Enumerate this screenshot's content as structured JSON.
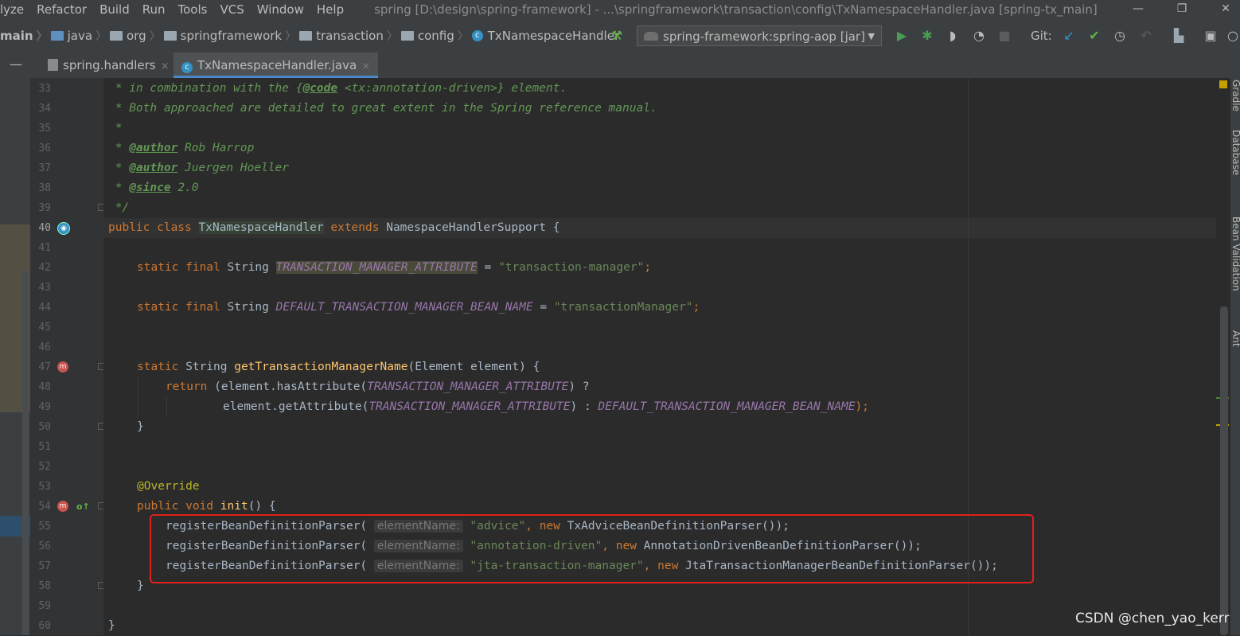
{
  "menu": [
    "lyze",
    "Refactor",
    "Build",
    "Run",
    "Tools",
    "VCS",
    "Window",
    "Help"
  ],
  "window_title": "spring [D:\\design\\spring-framework] - ...\\springframework\\transaction\\config\\TxNamespaceHandler.java [spring-tx_main]",
  "window_controls": {
    "minimize": "—",
    "restore": "❐",
    "close": "✕"
  },
  "breadcrumbs": [
    "main",
    "java",
    "org",
    "springframework",
    "transaction",
    "config",
    "TxNamespaceHandler"
  ],
  "run_config": "spring-framework:spring-aop [jar]",
  "toolbar": {
    "git_label": "Git:"
  },
  "icons": {
    "build": "hammer-icon",
    "run": "run-icon",
    "debug": "debug-icon",
    "coverage": "coverage-icon",
    "profile": "profile-icon",
    "stop": "stop-icon",
    "vcs_update": "vcs-update-icon",
    "vcs_commit": "vcs-commit-icon",
    "history": "history-icon",
    "rollback": "rollback-icon",
    "project_structure": "project-structure-icon",
    "terminal": "terminal-icon",
    "search": "search-icon"
  },
  "tabs": [
    {
      "label": "spring.handlers",
      "close": "×"
    },
    {
      "label": "TxNamespaceHandler.java",
      "close": "×"
    }
  ],
  "right_tool_windows": [
    "Gradle",
    "Database",
    "Bean Validation",
    "Ant"
  ],
  "line_numbers": [
    "33",
    "34",
    "35",
    "36",
    "37",
    "38",
    "39",
    "40",
    "41",
    "42",
    "43",
    "44",
    "45",
    "46",
    "47",
    "48",
    "49",
    "50",
    "51",
    "52",
    "53",
    "54",
    "55",
    "56",
    "57",
    "58",
    "59",
    "60"
  ],
  "code": {
    "l33": {
      "star": " * ",
      "t1": "in combination with the {",
      "tag": "@code",
      "t2": " <tx:annotation-driven>} element."
    },
    "l34": {
      "t": " * Both approached are detailed to great extent in the Spring reference manual."
    },
    "l35": {
      "t": " *"
    },
    "l36": {
      "star": " * ",
      "tag": "@author",
      "t": " Rob Harrop"
    },
    "l37": {
      "star": " * ",
      "tag": "@author",
      "t": " Juergen Hoeller"
    },
    "l38": {
      "star": " * ",
      "tag": "@since",
      "t": " 2.0"
    },
    "l39": {
      "t": " */"
    },
    "l40": {
      "kw1": "public class ",
      "cls": "TxNamespaceHandler",
      "kw2": " extends ",
      "t": "NamespaceHandlerSupport {"
    },
    "l42": {
      "kw": "static final ",
      "type": "String ",
      "fld": "TRANSACTION_MANAGER_ATTRIBUTE",
      "eq": " = ",
      "str": "\"transaction-manager\"",
      "end": ";"
    },
    "l44": {
      "kw": "static final ",
      "type": "String ",
      "fld": "DEFAULT_TRANSACTION_MANAGER_BEAN_NAME",
      "eq": " = ",
      "str": "\"transactionManager\"",
      "end": ";"
    },
    "l47": {
      "kw": "static ",
      "type": "String ",
      "fn": "getTransactionManagerName",
      "t": "(Element element) {"
    },
    "l48": {
      "kw": "return ",
      "t1": "(element.hasAttribute(",
      "fld": "TRANSACTION_MANAGER_ATTRIBUTE",
      "t2": ") ?"
    },
    "l49": {
      "t1": "element.getAttribute(",
      "fld1": "TRANSACTION_MANAGER_ATTRIBUTE",
      "t2": ") : ",
      "fld2": "DEFAULT_TRANSACTION_MANAGER_BEAN_NAME",
      "t3": ");"
    },
    "l50": {
      "t": "}"
    },
    "l53": {
      "ann": "@Override"
    },
    "l54": {
      "kw": "public void ",
      "fn": "init",
      "t": "() {"
    },
    "l55": {
      "call": "registerBeanDefinitionParser(",
      "hint": "elementName:",
      "str": "\"advice\"",
      "sep": ", ",
      "kw": "new ",
      "t": "TxAdviceBeanDefinitionParser());"
    },
    "l56": {
      "call": "registerBeanDefinitionParser(",
      "hint": "elementName:",
      "str": "\"annotation-driven\"",
      "sep": ", ",
      "kw": "new ",
      "t": "AnnotationDrivenBeanDefinitionParser());"
    },
    "l57": {
      "call": "registerBeanDefinitionParser(",
      "hint": "elementName:",
      "str": "\"jta-transaction-manager\"",
      "sep": ", ",
      "kw": "new ",
      "t": "JtaTransactionManagerBeanDefinitionParser());"
    },
    "l58": {
      "t": "}"
    },
    "l60": {
      "t": "}"
    }
  },
  "watermark": "CSDN @chen_yao_kerr",
  "colors": {
    "keyword": "#cc7832",
    "string": "#6a8759",
    "comment": "#629755",
    "field": "#9876aa",
    "method": "#ffc66d",
    "annotation": "#bbb529",
    "highlight_box": "#e0201b"
  }
}
